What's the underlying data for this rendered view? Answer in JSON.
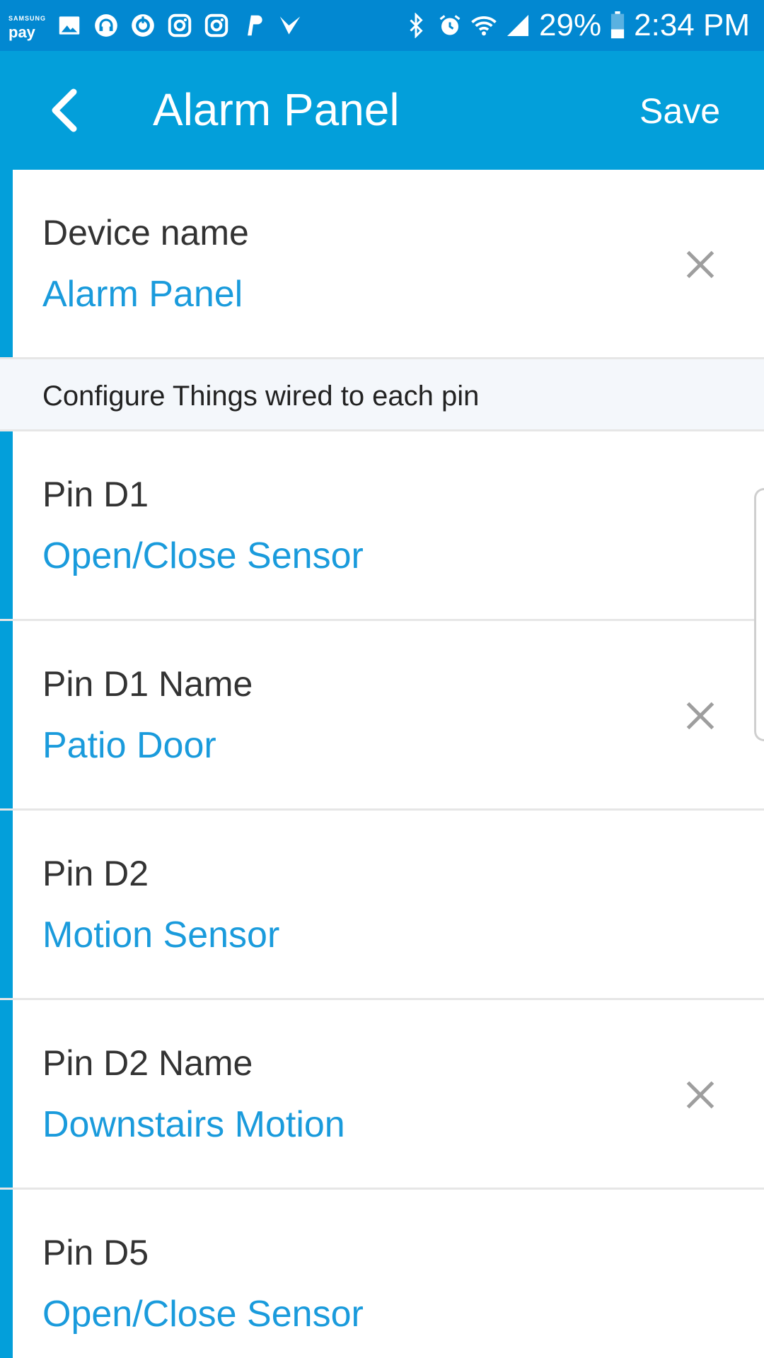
{
  "status_bar": {
    "pay_brand": "SAMSUNG",
    "pay_label": "pay",
    "battery": "29%",
    "time": "2:34 PM",
    "left_icons": [
      "gallery-icon",
      "headset-icon",
      "sync-icon",
      "instagram-icon",
      "instagram-icon",
      "paypal-icon",
      "check-icon"
    ],
    "right_icons": [
      "bluetooth-icon",
      "alarm-icon",
      "wifi-icon",
      "signal-icon",
      "battery-icon"
    ]
  },
  "app_bar": {
    "title": "Alarm Panel",
    "save_label": "Save",
    "back_icon": "chevron-left-icon"
  },
  "device": {
    "label": "Device name",
    "value": "Alarm Panel"
  },
  "section": {
    "header": "Configure Things wired to each pin"
  },
  "pins": [
    {
      "label": "Pin D1",
      "value": "Open/Close Sensor",
      "clearable": false
    },
    {
      "label": "Pin D1 Name",
      "value": "Patio Door",
      "clearable": true
    },
    {
      "label": "Pin D2",
      "value": "Motion Sensor",
      "clearable": false
    },
    {
      "label": "Pin D2 Name",
      "value": "Downstairs Motion",
      "clearable": true
    },
    {
      "label": "Pin D5",
      "value": "Open/Close Sensor",
      "clearable": false
    }
  ],
  "colors": {
    "app_bar": "#039fda",
    "status_bar": "#0288d1",
    "accent": "#039fda",
    "value_text": "#1a9bdc",
    "section_bg": "#f4f7fb"
  }
}
